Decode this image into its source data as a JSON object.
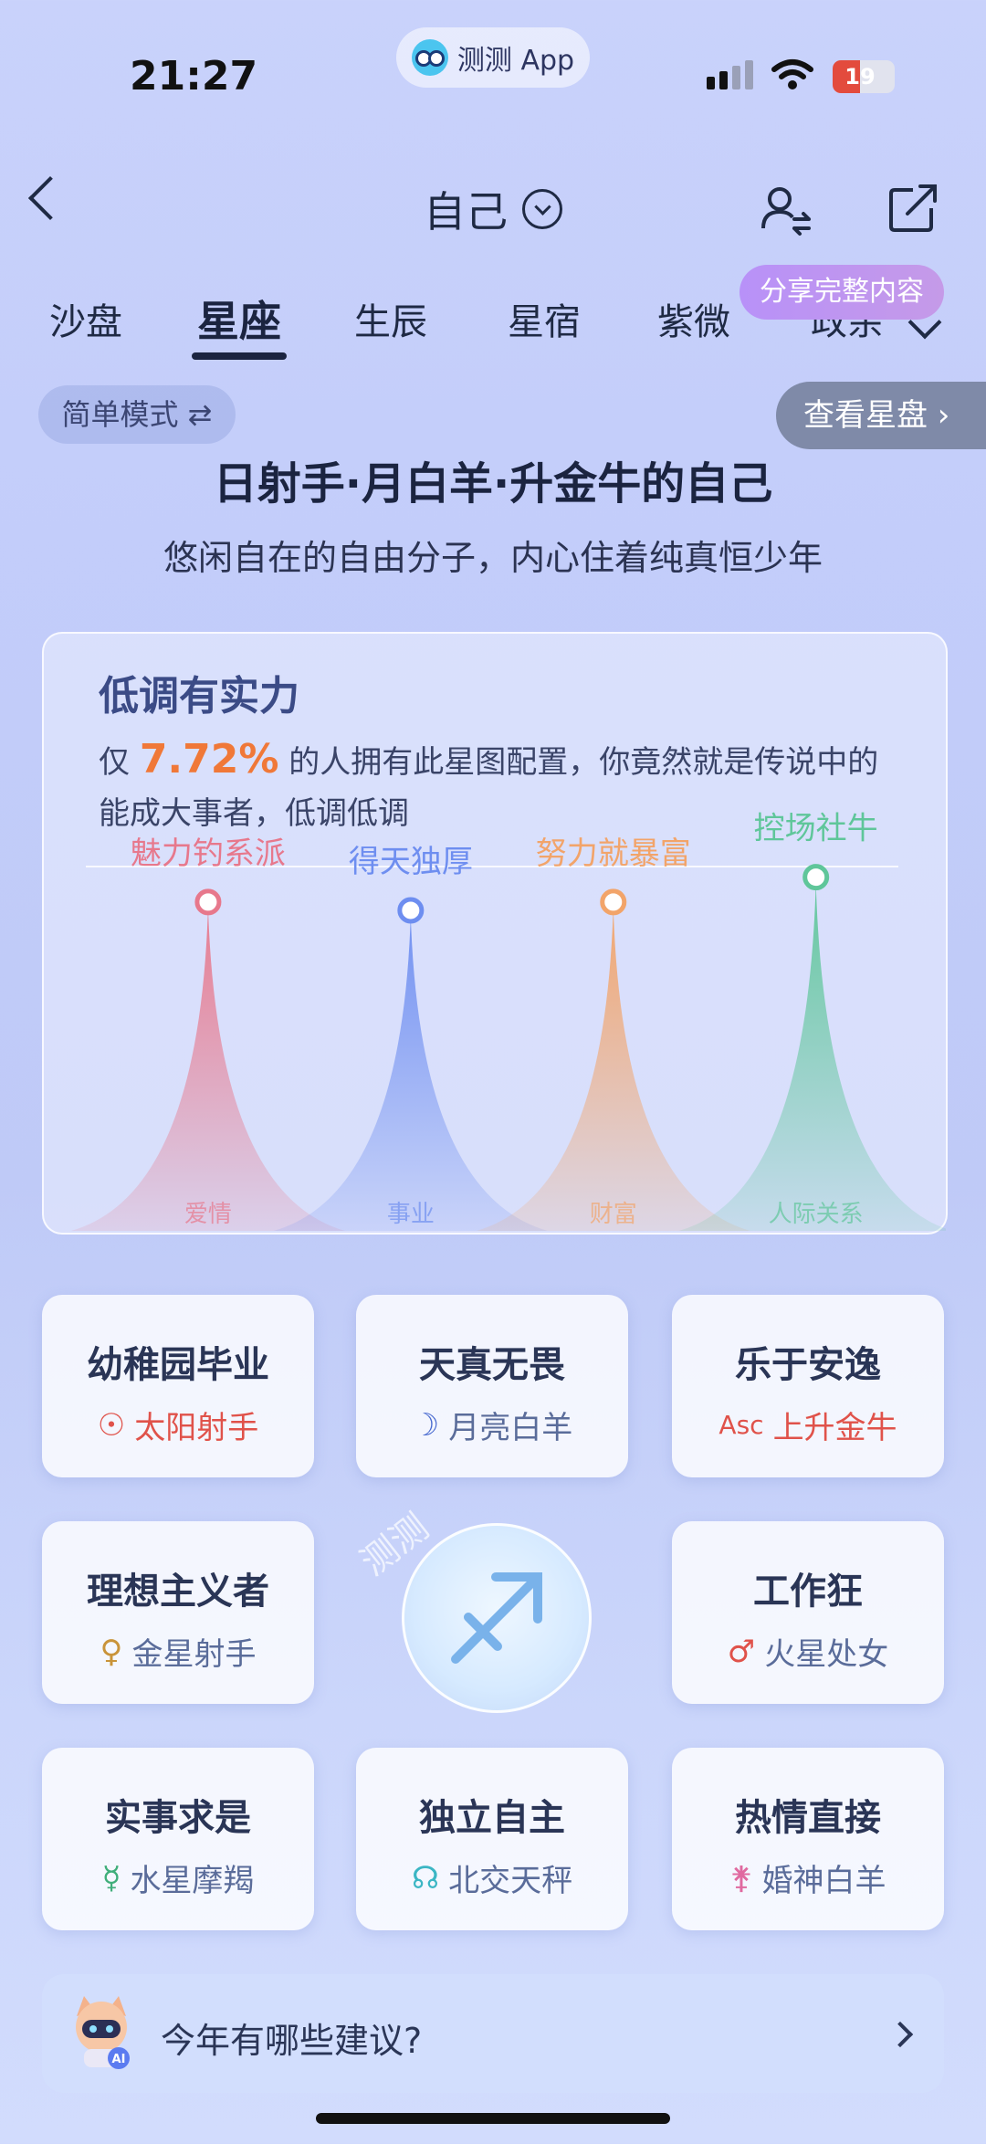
{
  "status_bar": {
    "time": "21:27",
    "app_pill": "测测 App",
    "battery": "19"
  },
  "header": {
    "back_icon": "chevron-left-icon",
    "title": "自己",
    "share_tip": "分享完整内容"
  },
  "tabs": [
    {
      "label": "沙盘",
      "active": false
    },
    {
      "label": "星座",
      "active": true
    },
    {
      "label": "生辰",
      "active": false
    },
    {
      "label": "星宿",
      "active": false
    },
    {
      "label": "紫微",
      "active": false
    },
    {
      "label": "政余",
      "active": false
    }
  ],
  "mode_toggle": "简单模式 ⇄",
  "view_chart": "查看星盘 ›",
  "headline": "日射手·月白羊·升金牛的自己",
  "subheadline": "悠闲自在的自由分子，内心住着纯真恒少年",
  "card": {
    "title": "低调有实力",
    "desc_prefix": "仅",
    "percent": "7.72%",
    "desc_rest": "的人拥有此星图配置，你竟然就是传说中的能成大事者，低调低调"
  },
  "chart_data": {
    "type": "area",
    "categories": [
      "爱情",
      "事业",
      "财富",
      "人际关系"
    ],
    "labels": [
      "魅力钓系派",
      "得天独厚",
      "努力就暴富",
      "控场社牛"
    ],
    "values": [
      78,
      76,
      78,
      84
    ],
    "colors": [
      "#e7788c",
      "#6e8ef0",
      "#f2a46a",
      "#5fc69a"
    ],
    "ylim": [
      0,
      100
    ]
  },
  "traits": [
    {
      "title": "幼稚园毕业",
      "symbol": "☉",
      "sub": "太阳射手",
      "color": "#e0524a"
    },
    {
      "title": "天真无畏",
      "symbol": "☽",
      "sub": "月亮白羊",
      "color": "#5a6c9a"
    },
    {
      "title": "乐于安逸",
      "symbol": "Asc",
      "sub": "上升金牛",
      "color": "#e0524a"
    },
    {
      "title": "理想主义者",
      "symbol": "♀",
      "sub": "金星射手",
      "color": "#5a6c9a"
    },
    {
      "title": "工作狂",
      "symbol": "♂",
      "sub": "火星处女",
      "color": "#5a6c9a"
    },
    {
      "title": "实事求是",
      "symbol": "☿",
      "sub": "水星摩羯",
      "color": "#5a6c9a"
    },
    {
      "title": "独立自主",
      "symbol": "☊",
      "sub": "北交天秤",
      "color": "#5a6c9a"
    },
    {
      "title": "热情直接",
      "symbol": "⚵",
      "sub": "婚神白羊",
      "color": "#5a6c9a"
    }
  ],
  "trait_symbol_colors": [
    "#e0524a",
    "#4a6bd0",
    "#e0524a",
    "#c9943a",
    "#e0524a",
    "#3fae7a",
    "#3bb6c4",
    "#e06aa0"
  ],
  "center_sign": "sagittarius-icon",
  "watermark": "测测",
  "ask": {
    "text": "今年有哪些建议?",
    "avatar": "robot-ai-icon",
    "badge": "AI"
  }
}
